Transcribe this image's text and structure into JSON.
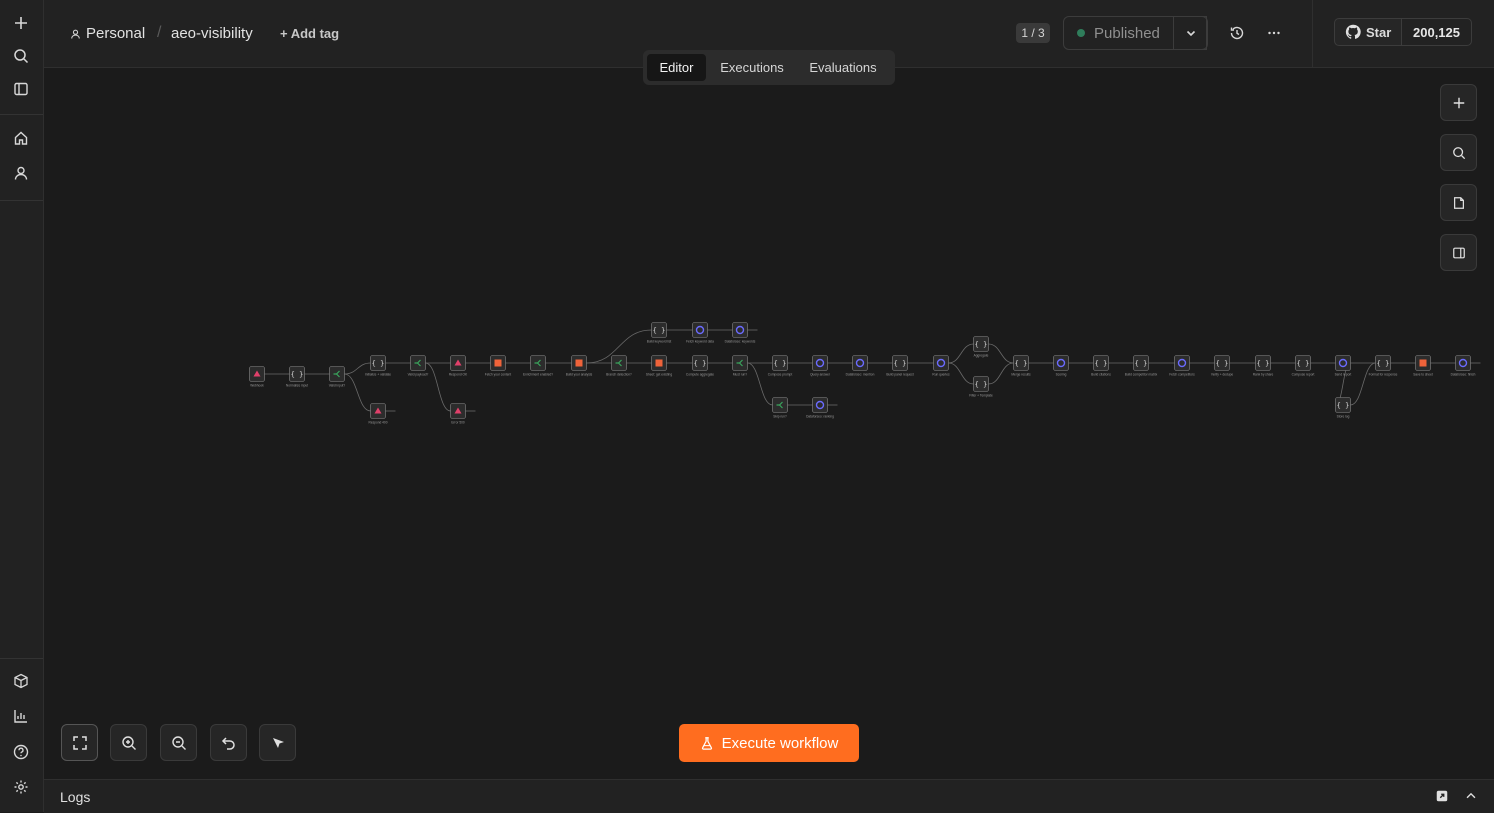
{
  "header": {
    "project": "Personal",
    "workflow_name": "aeo-visibility",
    "add_tag": "+ Add tag",
    "version_indicator": "1 / 3",
    "status": "Published",
    "github_star": "Star",
    "github_count": "200,125"
  },
  "tabs": [
    {
      "label": "Editor",
      "active": true
    },
    {
      "label": "Executions",
      "active": false
    },
    {
      "label": "Evaluations",
      "active": false
    }
  ],
  "execute_button": "Execute workflow",
  "logs_label": "Logs",
  "colors": {
    "accent": "#ff6d1f",
    "published_dot": "#2f7d5b",
    "node_code": "#d8d8d8",
    "node_if": "#3aa55d",
    "node_http": "#6b6bff",
    "node_webhook": "#e0406a",
    "node_sheet": "#f0633a"
  },
  "sidebar_icons": [
    "plus-icon",
    "search-icon",
    "panel-icon",
    "home-icon",
    "user-icon",
    "cube-icon",
    "chart-icon",
    "help-icon",
    "settings-icon"
  ],
  "canvas_nodes": [
    {
      "id": "n1",
      "kind": "webhook",
      "label": "Webhook"
    },
    {
      "id": "n2",
      "kind": "code",
      "label": "Normalize input"
    },
    {
      "id": "n3",
      "kind": "if",
      "label": "Valid input?"
    },
    {
      "id": "n4",
      "kind": "code",
      "label": "Initialize + validate"
    },
    {
      "id": "n5",
      "kind": "if",
      "label": "Valid payload?"
    },
    {
      "id": "n6",
      "kind": "webhook",
      "label": "Respond 400"
    },
    {
      "id": "n7",
      "kind": "webhook",
      "label": "Respond OK"
    },
    {
      "id": "n8",
      "kind": "webhook",
      "label": "Error 500"
    },
    {
      "id": "n9",
      "kind": "sheet",
      "label": "Fetch your content"
    },
    {
      "id": "n10",
      "kind": "if",
      "label": "Enrichment enabled?"
    },
    {
      "id": "n11",
      "kind": "sheet",
      "label": "Build your analysis"
    },
    {
      "id": "n12",
      "kind": "if",
      "label": "Branch detection?"
    },
    {
      "id": "n13",
      "kind": "code",
      "label": "Build keyword list"
    },
    {
      "id": "n14",
      "kind": "http",
      "label": "Fetch keyword data"
    },
    {
      "id": "n15",
      "kind": "http",
      "label": "Dataforseo: keywords"
    },
    {
      "id": "n16",
      "kind": "sheet",
      "label": "Sheet: get existing"
    },
    {
      "id": "n17",
      "kind": "code",
      "label": "Compute aggregate"
    },
    {
      "id": "n18",
      "kind": "if",
      "label": "Must run?"
    },
    {
      "id": "n19",
      "kind": "if",
      "label": "Skip run?"
    },
    {
      "id": "n20",
      "kind": "http",
      "label": "Dataforseo: ranking"
    },
    {
      "id": "n21",
      "kind": "code",
      "label": "Compose prompt"
    },
    {
      "id": "n22",
      "kind": "http",
      "label": "Query answer"
    },
    {
      "id": "n23",
      "kind": "http",
      "label": "Dataforseo: mention"
    },
    {
      "id": "n24",
      "kind": "code",
      "label": "Build panel request"
    },
    {
      "id": "n25",
      "kind": "http",
      "label": "Run queries"
    },
    {
      "id": "n26",
      "kind": "code",
      "label": "Aggregate"
    },
    {
      "id": "n27",
      "kind": "code",
      "label": "Filter + Template"
    },
    {
      "id": "n28",
      "kind": "code",
      "label": "Merge results"
    },
    {
      "id": "n29",
      "kind": "http",
      "label": "Scoring"
    },
    {
      "id": "n30",
      "kind": "code",
      "label": "Build citations"
    },
    {
      "id": "n31",
      "kind": "code",
      "label": "Build competitor matrix"
    },
    {
      "id": "n32",
      "kind": "http",
      "label": "Fetch competitors"
    },
    {
      "id": "n33",
      "kind": "code",
      "label": "Verify + dedupe"
    },
    {
      "id": "n34",
      "kind": "code",
      "label": "Rank by share"
    },
    {
      "id": "n35",
      "kind": "code",
      "label": "Compose report"
    },
    {
      "id": "n36",
      "kind": "http",
      "label": "Send report"
    },
    {
      "id": "n37",
      "kind": "code",
      "label": "Store log"
    },
    {
      "id": "n38",
      "kind": "code",
      "label": "Format for response"
    },
    {
      "id": "n39",
      "kind": "sheet",
      "label": "Save to sheet"
    },
    {
      "id": "n40",
      "kind": "http",
      "label": "Dataforseo: finish"
    }
  ]
}
